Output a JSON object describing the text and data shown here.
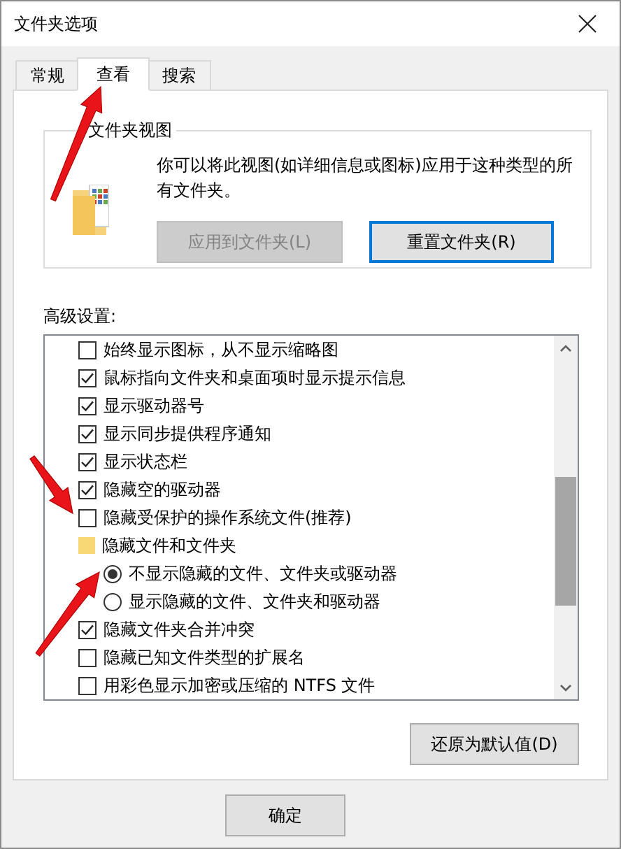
{
  "window": {
    "title": "文件夹选项"
  },
  "tabs": [
    {
      "label": "常规",
      "selected": false,
      "arrow": false
    },
    {
      "label": "查看",
      "selected": true,
      "arrow": true
    },
    {
      "label": "搜索",
      "selected": false,
      "arrow": false
    }
  ],
  "folder_views": {
    "title": "文件夹视图",
    "description": "你可以将此视图(如详细信息或图标)应用于这种类型的所有文件夹。",
    "buttons": [
      {
        "label": "应用到文件夹(L)",
        "disabled": true,
        "focused": false
      },
      {
        "label": "重置文件夹(R)",
        "disabled": false,
        "focused": true
      }
    ]
  },
  "advanced": {
    "label": "高级设置:",
    "items": [
      {
        "kind": "checkbox",
        "label": "始终显示图标，从不显示缩略图",
        "checked": false,
        "arrow": false
      },
      {
        "kind": "checkbox",
        "label": "鼠标指向文件夹和桌面项时显示提示信息",
        "checked": true,
        "arrow": false
      },
      {
        "kind": "checkbox",
        "label": "显示驱动器号",
        "checked": true,
        "arrow": false
      },
      {
        "kind": "checkbox",
        "label": "显示同步提供程序通知",
        "checked": true,
        "arrow": false
      },
      {
        "kind": "checkbox",
        "label": "显示状态栏",
        "checked": true,
        "arrow": false
      },
      {
        "kind": "checkbox",
        "label": "隐藏空的驱动器",
        "checked": true,
        "arrow": false
      },
      {
        "kind": "checkbox",
        "label": "隐藏受保护的操作系统文件(推荐)",
        "checked": false,
        "arrow": true
      },
      {
        "kind": "folder",
        "label": "隐藏文件和文件夹",
        "children": [
          {
            "kind": "radio",
            "label": "不显示隐藏的文件、文件夹或驱动器",
            "selected": true,
            "arrow": true
          },
          {
            "kind": "radio",
            "label": "显示隐藏的文件、文件夹和驱动器",
            "selected": false,
            "arrow": false
          }
        ]
      },
      {
        "kind": "checkbox",
        "label": "隐藏文件夹合并冲突",
        "checked": true,
        "arrow": false
      },
      {
        "kind": "checkbox",
        "label": "隐藏已知文件类型的扩展名",
        "checked": false,
        "arrow": false
      },
      {
        "kind": "checkbox",
        "label": "用彩色显示加密或压缩的 NTFS 文件",
        "checked": false,
        "arrow": false
      }
    ],
    "restore_button": "还原为默认值(D)"
  },
  "buttons": [
    {
      "label": "确定"
    }
  ]
}
